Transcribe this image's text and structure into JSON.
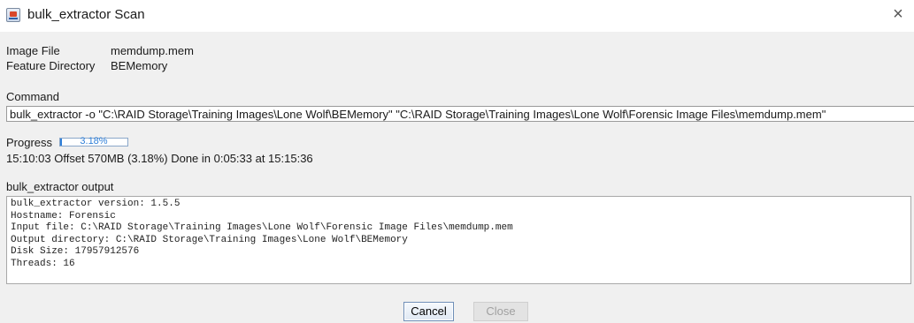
{
  "window": {
    "title": "bulk_extractor Scan",
    "close_glyph": "×"
  },
  "info": {
    "image_file_label": "Image File",
    "image_file_value": "memdump.mem",
    "feature_dir_label": "Feature Directory",
    "feature_dir_value": "BEMemory"
  },
  "command": {
    "label": "Command",
    "value": "bulk_extractor -o \"C:\\RAID Storage\\Training Images\\Lone Wolf\\BEMemory\" \"C:\\RAID Storage\\Training Images\\Lone Wolf\\Forensic Image Files\\memdump.mem\""
  },
  "progress": {
    "label": "Progress",
    "percent_text": "3.18%",
    "fraction": 0.0318,
    "status": "15:10:03 Offset 570MB (3.18%) Done in  0:05:33 at 15:15:36"
  },
  "output": {
    "label": "bulk_extractor output",
    "lines": [
      "bulk_extractor version: 1.5.5",
      "Hostname: Forensic",
      "Input file: C:\\RAID Storage\\Training Images\\Lone Wolf\\Forensic Image Files\\memdump.mem",
      "Output directory: C:\\RAID Storage\\Training Images\\Lone Wolf\\BEMemory",
      "Disk Size: 17957912576",
      "Threads: 16"
    ]
  },
  "buttons": {
    "cancel": "Cancel",
    "close": "Close"
  },
  "icons": {
    "app": "java-app-icon",
    "close": "close-icon"
  }
}
